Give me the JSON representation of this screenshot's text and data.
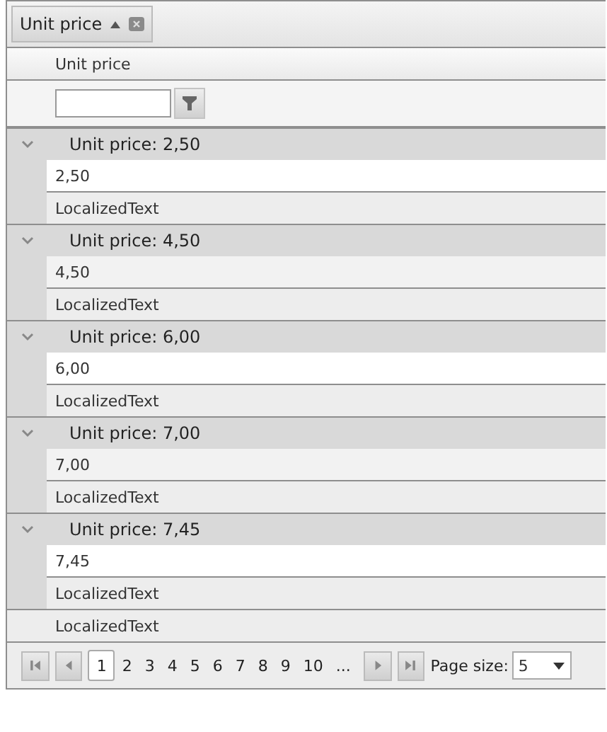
{
  "group_panel": {
    "chip": {
      "label": "Unit price",
      "sort_ascending": true
    }
  },
  "columns": [
    {
      "title": "Unit price"
    }
  ],
  "groups": [
    {
      "header": "Unit price: 2,50",
      "expanded": true,
      "rows": [
        {
          "value": "2,50"
        }
      ],
      "footer": "LocalizedText"
    },
    {
      "header": "Unit price: 4,50",
      "expanded": true,
      "rows": [
        {
          "value": "4,50"
        }
      ],
      "footer": "LocalizedText"
    },
    {
      "header": "Unit price: 6,00",
      "expanded": true,
      "rows": [
        {
          "value": "6,00"
        }
      ],
      "footer": "LocalizedText"
    },
    {
      "header": "Unit price: 7,00",
      "expanded": true,
      "rows": [
        {
          "value": "7,00"
        }
      ],
      "footer": "LocalizedText"
    },
    {
      "header": "Unit price: 7,45",
      "expanded": true,
      "rows": [
        {
          "value": "7,45"
        }
      ],
      "footer": "LocalizedText"
    }
  ],
  "grid_footer": "LocalizedText",
  "pager": {
    "pages": [
      {
        "label": "1",
        "selected": true
      },
      {
        "label": "2",
        "selected": false
      },
      {
        "label": "3",
        "selected": false
      },
      {
        "label": "4",
        "selected": false
      },
      {
        "label": "5",
        "selected": false
      },
      {
        "label": "6",
        "selected": false
      },
      {
        "label": "7",
        "selected": false
      },
      {
        "label": "8",
        "selected": false
      },
      {
        "label": "9",
        "selected": false
      },
      {
        "label": "10",
        "selected": false
      },
      {
        "label": "...",
        "selected": false
      }
    ],
    "page_size_label": "Page size:",
    "page_size": "5"
  }
}
